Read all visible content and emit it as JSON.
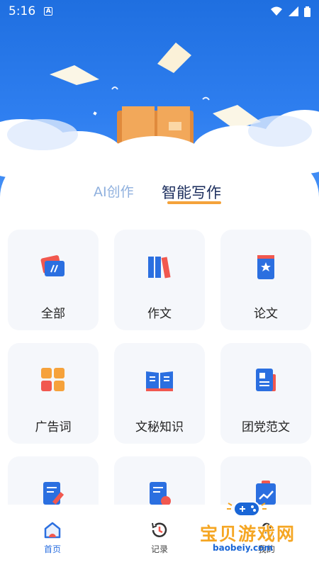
{
  "status": {
    "time": "5:16"
  },
  "tabs": [
    {
      "label": "AI创作",
      "active": false
    },
    {
      "label": "智能写作",
      "active": true
    }
  ],
  "tiles": [
    {
      "label": "全部",
      "icon": "cards-icon"
    },
    {
      "label": "作文",
      "icon": "books-icon"
    },
    {
      "label": "论文",
      "icon": "star-badge-icon"
    },
    {
      "label": "广告词",
      "icon": "grid-icon"
    },
    {
      "label": "文秘知识",
      "icon": "open-book-icon"
    },
    {
      "label": "团党范文",
      "icon": "document-icon"
    },
    {
      "label": "",
      "icon": "edit-note-icon"
    },
    {
      "label": "",
      "icon": "clock-doc-icon"
    },
    {
      "label": "",
      "icon": "chart-clipboard-icon"
    }
  ],
  "tabbar": [
    {
      "label": "首页",
      "active": true
    },
    {
      "label": "记录",
      "active": false
    },
    {
      "label": "我的",
      "active": false
    }
  ],
  "watermark": {
    "text": "宝贝游戏网",
    "url": "baobeiy.com"
  },
  "colors": {
    "primary": "#2b6fe0",
    "accent": "#f4a23a",
    "tile_bg": "#f5f7fb"
  }
}
